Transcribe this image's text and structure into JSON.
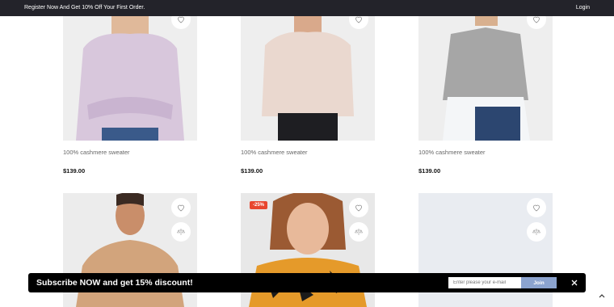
{
  "topbar": {
    "promo": "Register Now And Get 10% Off Your First Order.",
    "login": "Login"
  },
  "products": [
    {
      "title": "100% cashmere sweater",
      "price": "$139.00",
      "color": "#d8c7dc"
    },
    {
      "title": "100% cashmere sweater",
      "price": "$139.00",
      "color": "#ead8cf"
    },
    {
      "title": "100% cashmere sweater",
      "price": "$139.00",
      "color": "#a6a6a6"
    },
    {
      "badge": "",
      "color": "#d2a47c"
    },
    {
      "badge": "-25%",
      "color": "#e59a2a"
    },
    {
      "badge": "",
      "color": "#e9ecf1"
    }
  ],
  "subscribe": {
    "message": "Subscribe NOW and get 15% discount!",
    "placeholder": "Enter please your e-mail",
    "join": "Join"
  },
  "colors": {
    "topbar_bg": "#23232a",
    "badge": "#e8462e",
    "join_button": "#8ba3cf"
  }
}
